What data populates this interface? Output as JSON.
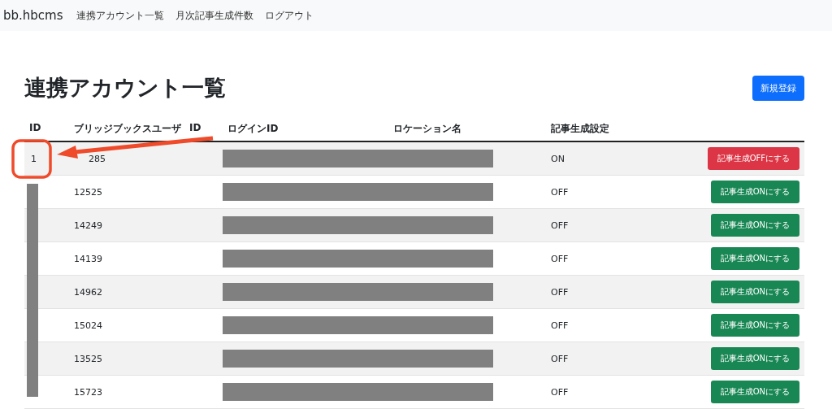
{
  "navbar": {
    "brand": "bb.hbcms",
    "links": [
      "連携アカウント一覧",
      "月次記事生成件数",
      "ログアウト"
    ]
  },
  "page": {
    "title": "連携アカウント一覧",
    "new_button": "新規登録"
  },
  "table": {
    "columns": [
      "ID",
      "ブリッジブックスユーザ",
      "ID",
      "ログインID",
      "ロケーション名",
      "記事生成設定"
    ],
    "rows": [
      {
        "id": "1",
        "user_id": "285",
        "setting": "ON",
        "enabled": true,
        "action": "記事生成OFFにする"
      },
      {
        "user_id": "12525",
        "setting": "OFF",
        "enabled": false,
        "action": "記事生成ONにする"
      },
      {
        "user_id": "14249",
        "setting": "OFF",
        "enabled": false,
        "action": "記事生成ONにする"
      },
      {
        "user_id": "14139",
        "setting": "OFF",
        "enabled": false,
        "action": "記事生成ONにする"
      },
      {
        "user_id": "14962",
        "setting": "OFF",
        "enabled": false,
        "action": "記事生成ONにする"
      },
      {
        "user_id": "15024",
        "setting": "OFF",
        "enabled": false,
        "action": "記事生成ONにする"
      },
      {
        "user_id": "13525",
        "setting": "OFF",
        "enabled": false,
        "action": "記事生成ONにする"
      },
      {
        "user_id": "15723",
        "setting": "OFF",
        "enabled": false,
        "action": "記事生成ONにする"
      }
    ]
  }
}
